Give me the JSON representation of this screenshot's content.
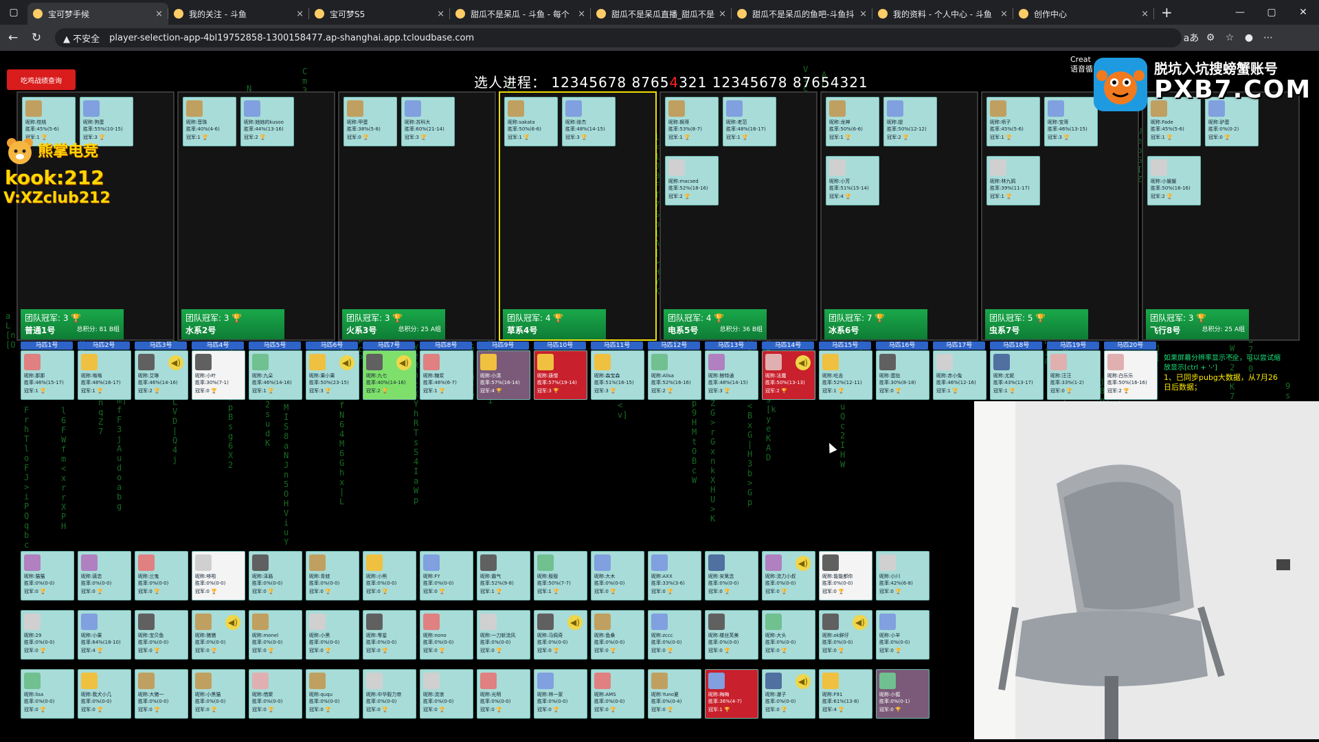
{
  "browser": {
    "tabs": [
      {
        "label": "宝可梦手候",
        "active": true
      },
      {
        "label": "我的关注 - 斗鱼"
      },
      {
        "label": "宝可梦S5",
        "muted": true
      },
      {
        "label": "甜瓜不是呆瓜 - 斗鱼 - 每个"
      },
      {
        "label": "甜瓜不是呆瓜直播_甜瓜不是"
      },
      {
        "label": "甜瓜不是呆瓜的鱼吧-斗鱼抖"
      },
      {
        "label": "我的资料 - 个人中心 - 斗鱼"
      },
      {
        "label": "创作中心"
      }
    ],
    "tab_close": "×",
    "new_tab": "+",
    "security_label": "不安全",
    "url": "player-selection-app-4bl19752858-1300158477.ap-shanghai.app.tcloudbase.com"
  },
  "page": {
    "title_prefix": "选人进程：",
    "title_numbers_a": "12345678 8765",
    "title_highlight": "4",
    "title_numbers_b": "321 12345678 87654321",
    "red_button": "吃鸡战绩查询",
    "right_header_1": "Creat",
    "right_header_2": "语音循"
  },
  "teams": [
    {
      "name": "普通1号",
      "champs": "团队冠军: 3",
      "score": "总积分: 81",
      "group": "B组",
      "players": [
        {
          "nick": "桂桃",
          "rate": "45%(5-6)",
          "cups": "1"
        },
        {
          "nick": "狗蛋",
          "rate": "55%(10-15)",
          "cups": "3"
        }
      ]
    },
    {
      "name": "水系2号",
      "champs": "团队冠军: 3",
      "score": "",
      "group": "",
      "players": [
        {
          "nick": "音珠",
          "rate": "40%(4-6)",
          "cups": "1"
        },
        {
          "nick": "她她的kusoo",
          "rate": "44%(13-16)",
          "cups": "2"
        }
      ]
    },
    {
      "name": "火系3号",
      "champs": "团队冠军: 3",
      "score": "总积分: 25",
      "group": "A组",
      "players": [
        {
          "nick": "甲蛋",
          "rate": "38%(5-8)",
          "cups": "0"
        },
        {
          "nick": "苏科大",
          "rate": "60%(21-14)",
          "cups": "3"
        }
      ]
    },
    {
      "name": "草系4号",
      "champs": "团队冠军: 4",
      "score": "",
      "group": "",
      "players": [
        {
          "nick": "sakata",
          "rate": "50%(6-6)",
          "cups": "1"
        },
        {
          "nick": "徐杰",
          "rate": "48%(14-15)",
          "cups": "3"
        }
      ]
    },
    {
      "name": "电系5号",
      "champs": "团队冠军: 4",
      "score": "总积分: 36",
      "group": "B组",
      "players": [
        {
          "nick": "枫哥",
          "rate": "53%(8-7)",
          "cups": "1"
        },
        {
          "nick": "老范",
          "rate": "48%(16-17)",
          "cups": "1"
        },
        {
          "nick": "macsed",
          "rate": "52%(18-16)",
          "cups": "2"
        }
      ]
    },
    {
      "name": "冰系6号",
      "champs": "团队冠军: 7",
      "score": "",
      "group": "",
      "players": [
        {
          "nick": "龙神",
          "rate": "50%(6-6)",
          "cups": "1"
        },
        {
          "nick": "提",
          "rate": "50%(12-12)",
          "cups": "2"
        },
        {
          "nick": "小芳",
          "rate": "51%(15-14)",
          "cups": "4"
        }
      ]
    },
    {
      "name": "虫系7号",
      "champs": "团队冠军: 5",
      "score": "",
      "group": "",
      "players": [
        {
          "nick": "喷子",
          "rate": "45%(5-6)",
          "cups": "1"
        },
        {
          "nick": "宝哥",
          "rate": "46%(13-15)",
          "cups": "3"
        },
        {
          "nick": "林九鸦",
          "rate": "39%(11-17)",
          "cups": "1"
        }
      ]
    },
    {
      "name": "飞行8号",
      "champs": "团队冠军: 3",
      "score": "总积分: 25",
      "group": "A组",
      "players": [
        {
          "nick": "Fade",
          "rate": "45%(5-6)",
          "cups": "1"
        },
        {
          "nick": "驴蛋",
          "rate": "0%(0-2)",
          "cups": "0"
        },
        {
          "nick": "小媛媛",
          "rate": "50%(16-16)",
          "cups": "2"
        }
      ]
    }
  ],
  "labels": {
    "nick": "昵称:",
    "rate": "胜率:",
    "cups": "冠军:"
  },
  "slots": [
    {
      "label": "马匹1号",
      "nick": "那那",
      "rate": "46%(15-17)",
      "cups": "1"
    },
    {
      "label": "马匹2号",
      "nick": "嗡嗡",
      "rate": "48%(16-17)",
      "cups": "1"
    },
    {
      "label": "马匹3号",
      "nick": "艾琳",
      "rate": "46%(14-16)",
      "cups": "2",
      "spk": true
    },
    {
      "label": "马匹4号",
      "nick": "小叶",
      "rate": "30%(7-1)",
      "cups": "0",
      "style": "white"
    },
    {
      "label": "马匹5号",
      "nick": "九朵",
      "rate": "46%(14-16)",
      "cups": "1"
    },
    {
      "label": "马匹6号",
      "nick": "果小果",
      "rate": "50%(23-15)",
      "cups": "3",
      "spk": true
    },
    {
      "label": "马匹7号",
      "nick": "九七",
      "rate": "40%(14-16)",
      "cups": "2",
      "style": "green",
      "spk": true
    },
    {
      "label": "马匹8号",
      "nick": "糖浆",
      "rate": "46%(6-7)",
      "cups": "1"
    },
    {
      "label": "马匹9号",
      "nick": "小清",
      "rate": "57%(16-14)",
      "cups": "4",
      "style": "dark"
    },
    {
      "label": "马匹10号",
      "nick": "唐僧",
      "rate": "57%(19-14)",
      "cups": "3",
      "style": "red"
    },
    {
      "label": "马匹11号",
      "nick": "森宝森",
      "rate": "51%(16-15)",
      "cups": "3"
    },
    {
      "label": "马匹12号",
      "nick": "Alisa",
      "rate": "52%(16-16)",
      "cups": "2"
    },
    {
      "label": "马匹13号",
      "nick": "鲸特通",
      "rate": "48%(14-15)",
      "cups": "3"
    },
    {
      "label": "马匹14号",
      "nick": "法魔",
      "rate": "50%(13-13)",
      "cups": "2",
      "style": "red",
      "spk": true
    },
    {
      "label": "马匹15号",
      "nick": "吃吉",
      "rate": "52%(12-11)",
      "cups": "1"
    },
    {
      "label": "马匹16号",
      "nick": "蛋挞",
      "rate": "30%(8-18)",
      "cups": "0"
    },
    {
      "label": "马匹17号",
      "nick": "赤小兔",
      "rate": "46%(12-16)",
      "cups": "1"
    },
    {
      "label": "马匹18号",
      "nick": "尤妮",
      "rate": "43%(13-17)",
      "cups": "1"
    },
    {
      "label": "马匹19号",
      "nick": "汪汪",
      "rate": "33%(1-2)",
      "cups": "0"
    },
    {
      "label": "马匹20号",
      "nick": "白乐乐",
      "rate": "50%(16-16)",
      "cups": "2",
      "style": "white"
    }
  ],
  "pool": [
    [
      {
        "nick": "猫猫",
        "rate": "0%(0-0)",
        "cups": "0"
      },
      {
        "nick": "唐恋",
        "rate": "0%(0-0)",
        "cups": "0"
      },
      {
        "nick": "兰鬼",
        "rate": "0%(0-0)",
        "cups": "0"
      },
      {
        "nick": "哆啦",
        "rate": "0%(0-0)",
        "cups": "0",
        "style": "white"
      },
      {
        "nick": "泽路",
        "rate": "0%(0-0)",
        "cups": "0"
      },
      {
        "nick": "青蛙",
        "rate": "0%(0-0)",
        "cups": "0"
      },
      {
        "nick": "小熊",
        "rate": "0%(0-0)",
        "cups": "0"
      },
      {
        "nick": "FY",
        "rate": "0%(0-0)",
        "cups": "0"
      },
      {
        "nick": "霸气",
        "rate": "52%(9-8)",
        "cups": "1"
      },
      {
        "nick": "殷殷",
        "rate": "50%(7-7)",
        "cups": "1"
      },
      {
        "nick": "大木",
        "rate": "0%(0-0)",
        "cups": "0"
      },
      {
        "nick": "AXX",
        "rate": "33%(3-6)",
        "cups": "0"
      },
      {
        "nick": "安篱念",
        "rate": "0%(0-0)",
        "cups": "0"
      },
      {
        "nick": "流力小叔",
        "rate": "0%(0-0)",
        "cups": "0",
        "spk": true
      },
      {
        "nick": "能能都你",
        "rate": "0%(0-0)",
        "cups": "0",
        "style": "white"
      },
      {
        "nick": "小川",
        "rate": "42%(6-8)",
        "cups": "0"
      },
      {
        "nick": "草草几",
        "rate": "0%(0-0)",
        "cups": "0"
      }
    ],
    [
      {
        "nick": "29",
        "rate": "0%(0-0)",
        "cups": "0"
      },
      {
        "nick": "小果",
        "rate": "64%(18-10)",
        "cups": "4"
      },
      {
        "nick": "宝贝鱼",
        "rate": "0%(0-0)",
        "cups": "0"
      },
      {
        "nick": "猪猪",
        "rate": "0%(0-0)",
        "cups": "0",
        "spk": true
      },
      {
        "nick": "monel",
        "rate": "0%(0-0)",
        "cups": "0"
      },
      {
        "nick": "小黑",
        "rate": "0%(0-0)",
        "cups": "0"
      },
      {
        "nick": "零星",
        "rate": "0%(0-0)",
        "cups": "0"
      },
      {
        "nick": "nono",
        "rate": "0%(0-0)",
        "cups": "0"
      },
      {
        "nick": "一刀斩流风",
        "rate": "0%(0-0)",
        "cups": "0"
      },
      {
        "nick": "马佩奇",
        "rate": "0%(0-0)",
        "cups": "0",
        "spk": true
      },
      {
        "nick": "鱼桑",
        "rate": "0%(0-0)",
        "cups": "0"
      },
      {
        "nick": "zccc",
        "rate": "0%(0-0)",
        "cups": "0"
      },
      {
        "nick": "楼丝芙美",
        "rate": "0%(0-0)",
        "cups": "0"
      },
      {
        "nick": "大头",
        "rate": "0%(0-0)",
        "cups": "0"
      },
      {
        "nick": "ok鲜仔",
        "rate": "0%(0-0)",
        "cups": "0",
        "spk": true
      },
      {
        "nick": "小羊",
        "rate": "0%(0-0)",
        "cups": "0"
      },
      {
        "nick": "天天",
        "rate": "0%(0-0)",
        "cups": "0"
      }
    ],
    [
      {
        "nick": "lisa",
        "rate": "0%(0-0)",
        "cups": "0"
      },
      {
        "nick": "我犬小几",
        "rate": "0%(0-0)",
        "cups": "0"
      },
      {
        "nick": "大猪一",
        "rate": "0%(0-0)",
        "cups": "0"
      },
      {
        "nick": "小黑猫",
        "rate": "0%(0-0)",
        "cups": "0"
      },
      {
        "nick": "借聚",
        "rate": "0%(0-0)",
        "cups": "0"
      },
      {
        "nick": "ququ",
        "rate": "0%(0-0)",
        "cups": "0"
      },
      {
        "nick": "中华毅力帝",
        "rate": "0%(0-0)",
        "cups": "0"
      },
      {
        "nick": "流浪",
        "rate": "0%(0-0)",
        "cups": "0"
      },
      {
        "nick": "光明",
        "rate": "0%(0-0)",
        "cups": "0"
      },
      {
        "nick": "林一家",
        "rate": "0%(0-0)",
        "cups": "0"
      },
      {
        "nick": "AMS",
        "rate": "0%(0-0)",
        "cups": "0"
      },
      {
        "nick": "Yuno夏",
        "rate": "0%(0-4)",
        "cups": "0"
      },
      {
        "nick": "梅梅",
        "rate": "36%(4-7)",
        "cups": "1",
        "style": "red"
      },
      {
        "nick": "瀑子",
        "rate": "0%(0-0)",
        "cups": "0",
        "spk": true
      },
      {
        "nick": "F91",
        "rate": "61%(13-8)",
        "cups": "4"
      },
      {
        "nick": "小狐",
        "rate": "0%(0-1)",
        "cups": "0",
        "style": "dark"
      },
      {
        "nick": "小色",
        "rate": "56%(1-1)",
        "cups": "3"
      }
    ]
  ],
  "notice": {
    "line1": "如果屏幕分辨率显示不全，可以尝试缩放显示[ctrl + '-']",
    "line2": "1、已同步pubg大数据，从7月26日后数据；"
  },
  "watermark": {
    "line1": "脱坑入坑搜螃蟹账号",
    "line2": "PXB7.COM"
  },
  "brand": {
    "name": "熊掌电竞",
    "kook": "kook:212",
    "vx": "V:XZclub212"
  },
  "colors": {
    "accent_green": "#1aa84a",
    "select_yellow": "#f0e000",
    "slot_blue": "#2e63c8",
    "card_teal": "#a8dcd8"
  }
}
